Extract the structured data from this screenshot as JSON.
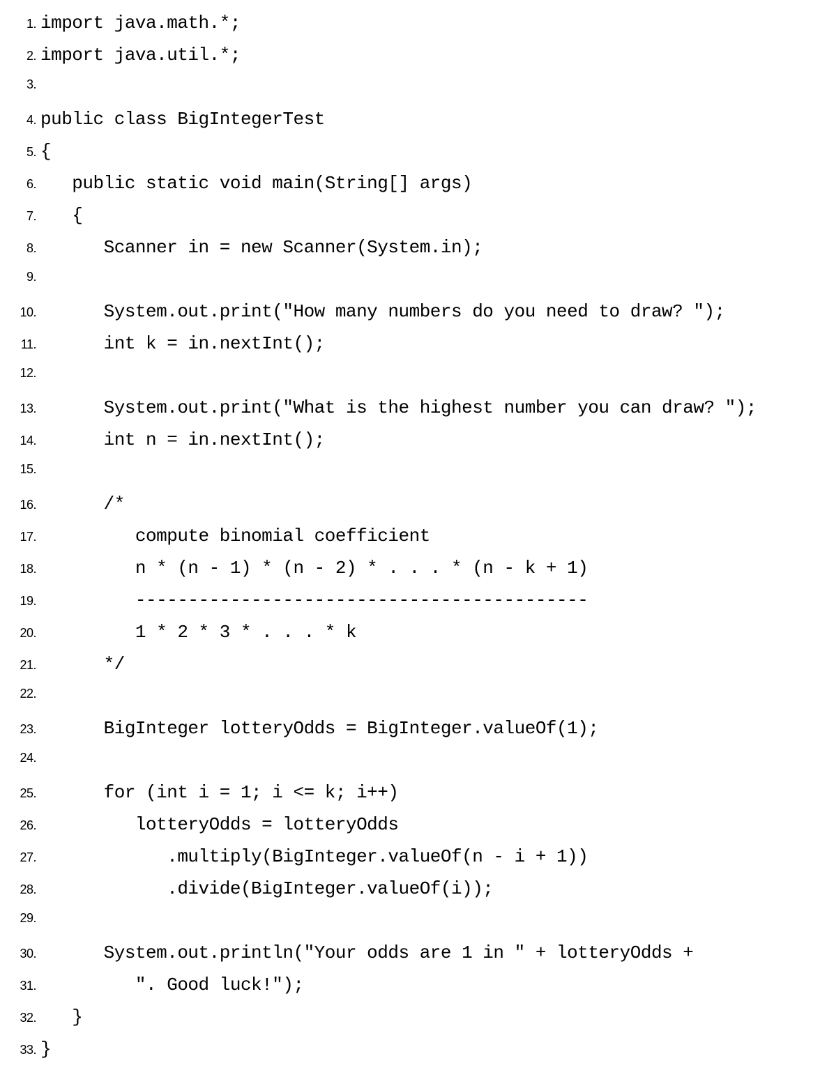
{
  "code": {
    "lines": [
      {
        "num": "1.",
        "text": "import java.math.*;"
      },
      {
        "num": "2.",
        "text": "import java.util.*;"
      },
      {
        "num": "3.",
        "text": ""
      },
      {
        "num": "4.",
        "text": "public class BigIntegerTest"
      },
      {
        "num": "5.",
        "text": "{"
      },
      {
        "num": "6.",
        "text": "   public static void main(String[] args)"
      },
      {
        "num": "7.",
        "text": "   {"
      },
      {
        "num": "8.",
        "text": "      Scanner in = new Scanner(System.in);"
      },
      {
        "num": "9.",
        "text": ""
      },
      {
        "num": "10.",
        "text": "      System.out.print(\"How many numbers do you need to draw? \");"
      },
      {
        "num": "11.",
        "text": "      int k = in.nextInt();"
      },
      {
        "num": "12.",
        "text": ""
      },
      {
        "num": "13.",
        "text": "      System.out.print(\"What is the highest number you can draw? \");"
      },
      {
        "num": "14.",
        "text": "      int n = in.nextInt();"
      },
      {
        "num": "15.",
        "text": ""
      },
      {
        "num": "16.",
        "text": "      /*"
      },
      {
        "num": "17.",
        "text": "         compute binomial coefficient"
      },
      {
        "num": "18.",
        "text": "         n * (n - 1) * (n - 2) * . . . * (n - k + 1)"
      },
      {
        "num": "19.",
        "text": "         -------------------------------------------"
      },
      {
        "num": "20.",
        "text": "         1 * 2 * 3 * . . . * k"
      },
      {
        "num": "21.",
        "text": "      */"
      },
      {
        "num": "22.",
        "text": ""
      },
      {
        "num": "23.",
        "text": "      BigInteger lotteryOdds = BigInteger.valueOf(1);"
      },
      {
        "num": "24.",
        "text": ""
      },
      {
        "num": "25.",
        "text": "      for (int i = 1; i <= k; i++)"
      },
      {
        "num": "26.",
        "text": "         lotteryOdds = lotteryOdds"
      },
      {
        "num": "27.",
        "text": "            .multiply(BigInteger.valueOf(n - i + 1))"
      },
      {
        "num": "28.",
        "text": "            .divide(BigInteger.valueOf(i));"
      },
      {
        "num": "29.",
        "text": ""
      },
      {
        "num": "30.",
        "text": "      System.out.println(\"Your odds are 1 in \" + lotteryOdds +"
      },
      {
        "num": "31.",
        "text": "         \". Good luck!\");"
      },
      {
        "num": "32.",
        "text": "   }"
      },
      {
        "num": "33.",
        "text": "}"
      }
    ]
  }
}
